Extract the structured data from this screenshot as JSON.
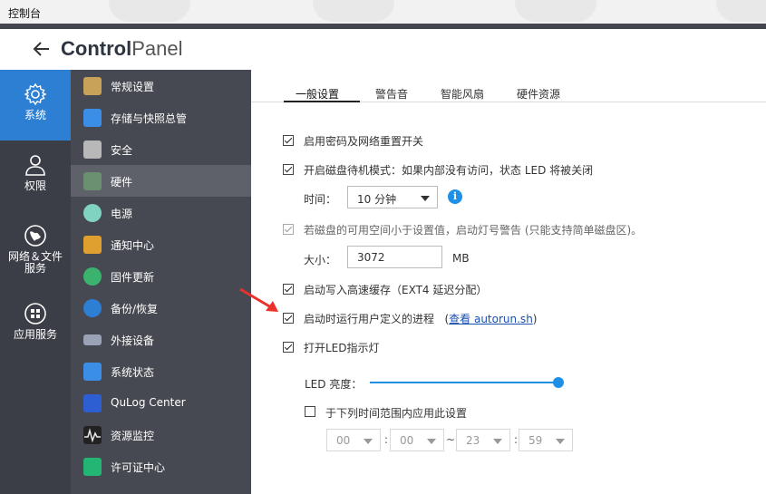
{
  "window": {
    "title": "控制台"
  },
  "header": {
    "title_bold": "Control",
    "title_light": "Panel"
  },
  "rail": [
    {
      "label": "系统",
      "icon": "gear-icon",
      "active": true
    },
    {
      "label": "权限",
      "icon": "user-icon",
      "active": false
    },
    {
      "label": "网络＆文件服务",
      "icon": "globe-icon",
      "active": false
    },
    {
      "label": "应用服务",
      "icon": "apps-grid-icon",
      "active": false
    }
  ],
  "menu": [
    {
      "label": "常规设置",
      "icon": "general-settings-icon",
      "color": "#c9a25a"
    },
    {
      "label": "存储与快照总管",
      "icon": "storage-icon",
      "color": "#3a8ee6"
    },
    {
      "label": "安全",
      "icon": "lock-icon",
      "color": "#b8b8b8"
    },
    {
      "label": "硬件",
      "icon": "hardware-icon",
      "color": "#6b8f71",
      "active": true
    },
    {
      "label": "电源",
      "icon": "power-bulb-icon",
      "color": "#7fd3c0"
    },
    {
      "label": "通知中心",
      "icon": "notification-icon",
      "color": "#e0a030"
    },
    {
      "label": "固件更新",
      "icon": "firmware-update-icon",
      "color": "#3bb36f"
    },
    {
      "label": "备份/恢复",
      "icon": "backup-icon",
      "color": "#2d7fd3"
    },
    {
      "label": "外接设备",
      "icon": "external-device-icon",
      "color": "#9aa3b5"
    },
    {
      "label": "系统状态",
      "icon": "system-status-icon",
      "color": "#3a8ee6"
    },
    {
      "label": "QuLog Center",
      "icon": "qulog-icon",
      "color": "#2d5fd3"
    },
    {
      "label": "资源监控",
      "icon": "resource-monitor-icon",
      "color": "#333333"
    },
    {
      "label": "许可证中心",
      "icon": "license-icon",
      "color": "#22b573"
    }
  ],
  "tabs": [
    {
      "label": "一般设置",
      "active": true
    },
    {
      "label": "警告音",
      "active": false
    },
    {
      "label": "智能风扇",
      "active": false
    },
    {
      "label": "硬件资源",
      "active": false
    }
  ],
  "settings": {
    "reset_switch": {
      "label": "启用密码及网络重置开关",
      "checked": true
    },
    "disk_standby": {
      "label": "开启磁盘待机模式：如果内部没有访问，状态 LED 将被关闭",
      "checked": true
    },
    "time_label": "时间：",
    "time_value": "10 分钟",
    "low_space": {
      "label": "若磁盘的可用空间小于设置值，启动灯号警告 (只能支持简单磁盘区)。",
      "checked": true,
      "disabled": true
    },
    "size_label": "大小：",
    "size_value": "3072",
    "size_unit": "MB",
    "write_cache": {
      "label": "启动写入高速缓存（EXT4 延迟分配）",
      "checked": true
    },
    "autorun": {
      "label": "启动时运行用户定义的进程",
      "checked": true,
      "link_prefix": "(",
      "link_text": "查看 autorun.sh",
      "link_suffix": ")"
    },
    "led": {
      "label": "打开LED指示灯",
      "checked": true
    },
    "led_brightness_label": "LED 亮度：",
    "led_brightness": 1.0,
    "schedule": {
      "label": "于下列时间范围内应用此设置",
      "checked": false
    },
    "schedule_time": {
      "start_h": "00",
      "start_m": "00",
      "tilde": "~",
      "end_h": "23",
      "end_m": "59",
      "colon": ":"
    }
  },
  "colors": {
    "accent": "#2d7fd3",
    "rail_bg": "#3b3e47",
    "menu_bg": "#464951",
    "arrow": "#e8322b"
  }
}
